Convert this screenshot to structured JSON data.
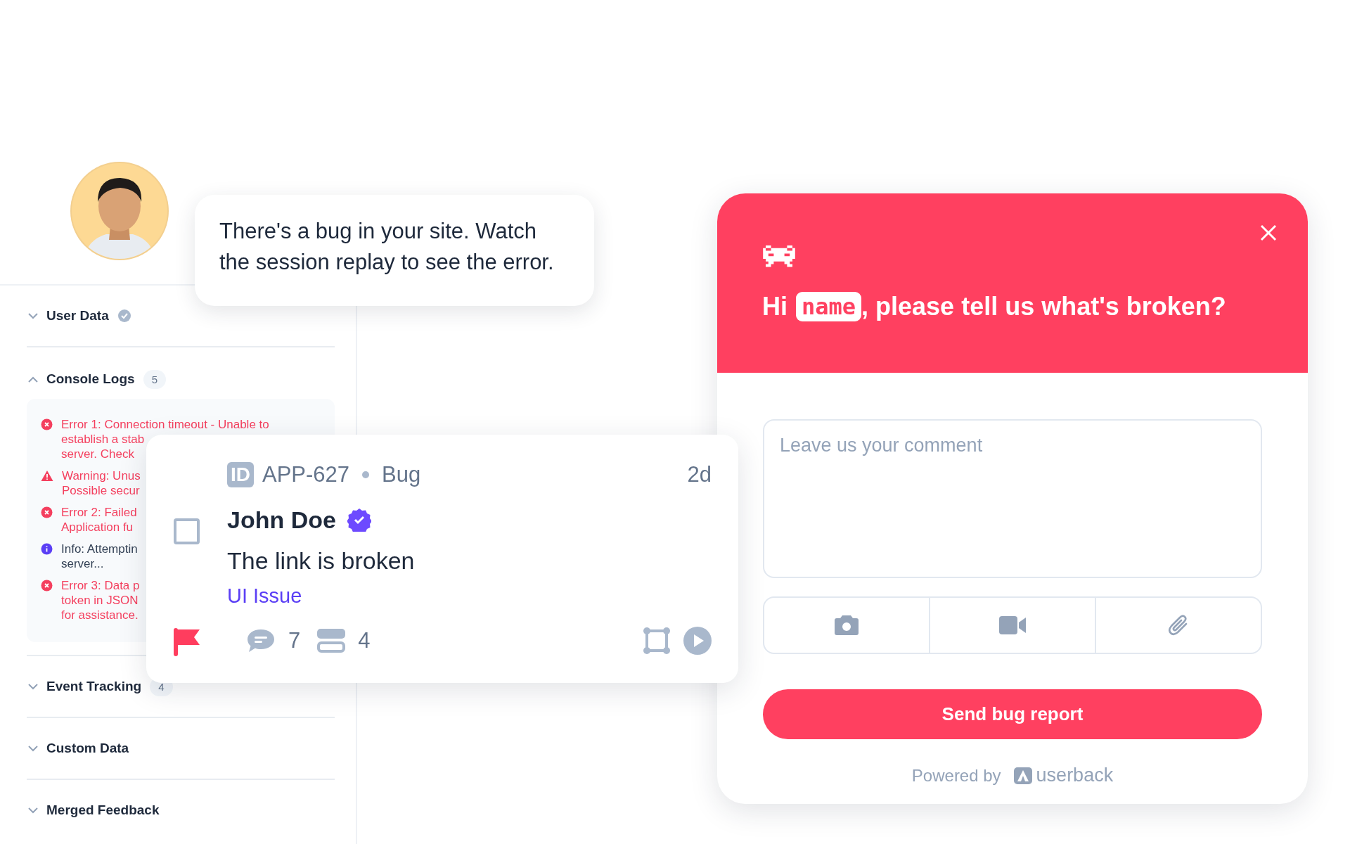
{
  "speech_bubble": {
    "text": "There's a bug in your site. Watch the session replay to see the error."
  },
  "sidebar": {
    "sections": [
      {
        "title": "User Data",
        "expanded": false,
        "verified": true
      },
      {
        "title": "Console Logs",
        "expanded": true,
        "count": "5",
        "logs": [
          {
            "kind": "error",
            "lines": [
              "Error 1: Connection timeout - Unable to",
              "establish a stab",
              "server. Check"
            ]
          },
          {
            "kind": "warning",
            "lines": [
              "Warning: Unus",
              "Possible secur"
            ]
          },
          {
            "kind": "error",
            "lines": [
              "Error 2: Failed",
              "Application fu"
            ]
          },
          {
            "kind": "info",
            "lines": [
              "Info: Attemptin",
              "server..."
            ]
          },
          {
            "kind": "error",
            "lines": [
              "Error 3: Data p",
              "token in JSON",
              "for assistance."
            ]
          }
        ]
      },
      {
        "title": "Event Tracking",
        "expanded": false,
        "count": "4"
      },
      {
        "title": "Custom Data",
        "expanded": false
      },
      {
        "title": "Merged Feedback",
        "expanded": false
      }
    ]
  },
  "issue_card": {
    "id_badge": "ID",
    "id": "APP-627",
    "type": "Bug",
    "age": "2d",
    "checked": false,
    "author": "John Doe",
    "author_verified": true,
    "title": "The link is broken",
    "tag": "UI Issue",
    "flagged": true,
    "comments": "7",
    "layers": "4"
  },
  "widget": {
    "greeting_before": "Hi",
    "name_token": "name",
    "greeting_after": ", please tell us what's broken?",
    "comment_placeholder": "Leave us your comment",
    "attachments": [
      {
        "kind": "screenshot"
      },
      {
        "kind": "video"
      },
      {
        "kind": "file"
      }
    ],
    "submit": "Send bug report",
    "powered_by": "Powered by",
    "brand": "userback"
  }
}
